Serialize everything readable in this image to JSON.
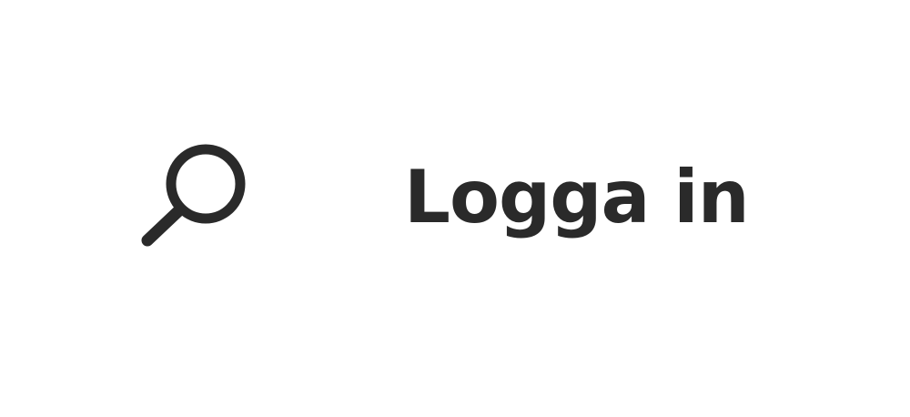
{
  "header": {
    "search": {
      "icon": "search-icon"
    },
    "login_label": "Logga in",
    "colors": {
      "text": "#2a2a2a",
      "icon": "#2a2a2a",
      "background": "#ffffff"
    }
  }
}
